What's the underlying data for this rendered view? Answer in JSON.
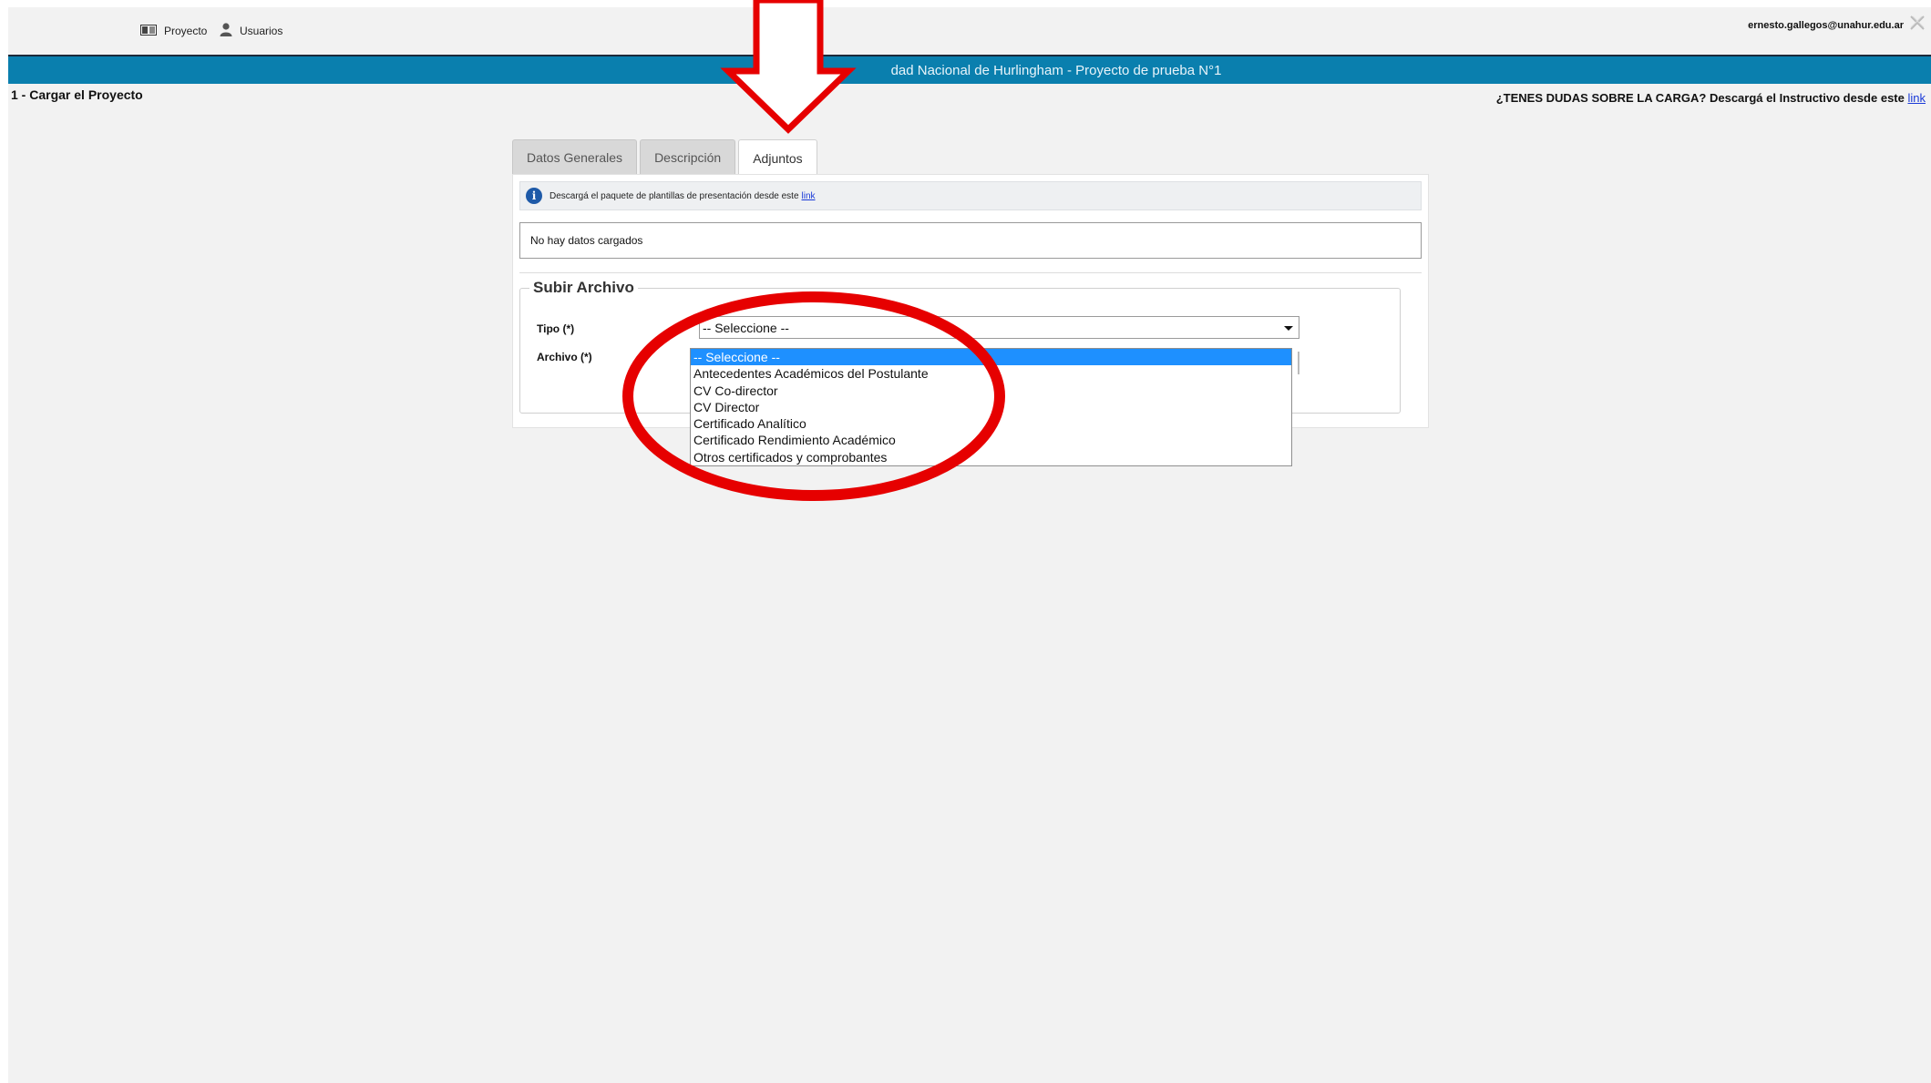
{
  "nav": {
    "items": [
      {
        "label": "Proyecto",
        "icon": "project-icon"
      },
      {
        "label": "Usuarios",
        "icon": "user-icon"
      }
    ],
    "user_email": "ernesto.gallegos@unahur.edu.ar"
  },
  "banner": {
    "title": "dad Nacional de Hurlingham - Proyecto de prueba N°1"
  },
  "step": {
    "title": "1 - Cargar el Proyecto"
  },
  "help": {
    "text": "¿TENES DUDAS SOBRE LA CARGA? Descargá el Instructivo desde este",
    "link": "link"
  },
  "tabs": [
    {
      "label": "Datos Generales",
      "active": false
    },
    {
      "label": "Descripción",
      "active": false
    },
    {
      "label": "Adjuntos",
      "active": true
    }
  ],
  "info": {
    "text": "Descargá el paquete de plantillas de presentación desde este",
    "link": "link"
  },
  "table": {
    "empty_text": "No hay datos cargados"
  },
  "upload": {
    "legend": "Subir Archivo",
    "tipo_label": "Tipo (*)",
    "archivo_label": "Archivo (*)",
    "select_value": "-- Seleccione --",
    "options": [
      "-- Seleccione --",
      "Antecedentes Académicos del Postulante",
      "CV Co-director",
      "CV Director",
      "Certificado Analítico",
      "Certificado Rendimiento Académico",
      "Otros certificados y comprobantes"
    ],
    "selected_index": 0
  },
  "colors": {
    "banner": "#0a7fae",
    "annotation_red": "#e60000",
    "selected_option": "#1e90ff",
    "background": "#f2f2f2"
  }
}
